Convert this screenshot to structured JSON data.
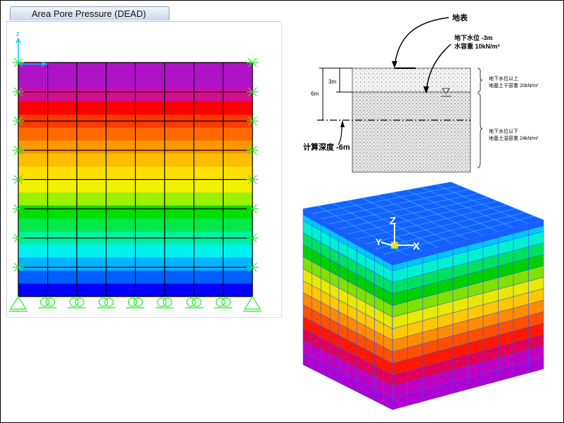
{
  "window": {
    "tab_label": "Area Pore Pressure (DEAD)"
  },
  "plot_2d": {
    "axis_z_label": "z",
    "axis_x_label": "x",
    "band_colors": [
      "#b012c8",
      "#b012c8",
      "#d20f8f",
      "#ff0000",
      "#ff3a00",
      "#ff6a00",
      "#ff9800",
      "#ffbd00",
      "#ffe000",
      "#f2f200",
      "#9cf000",
      "#00e000",
      "#00e84a",
      "#00f0a0",
      "#00f0f0",
      "#00b4ff",
      "#0060ff",
      "#0000ff"
    ]
  },
  "diagram": {
    "surface_label": "地表",
    "gwl_label": "地下水位 -3m",
    "water_unit_weight": "水容重 10kN/m³",
    "depth_3m": "3m",
    "depth_6m": "6m",
    "above_gwl_title": "地下水位以上",
    "above_gwl_value": "地基土干容重 20kN/m³",
    "below_gwl_title": "地下水位以下",
    "below_gwl_value": "地基土湿容重 24kN/m³",
    "calc_depth": "计算深度 -6m"
  },
  "view_3d": {
    "axis_z": "Z",
    "axis_x": "X",
    "axis_y": "Y",
    "band_colors_top_to_bottom": [
      "#00c8ff",
      "#00f0d0",
      "#00e060",
      "#00d000",
      "#80e000",
      "#e8e800",
      "#ffc800",
      "#ff8c00",
      "#ff5000",
      "#ff1800",
      "#e0005a",
      "#c000c0",
      "#b000d0"
    ]
  }
}
